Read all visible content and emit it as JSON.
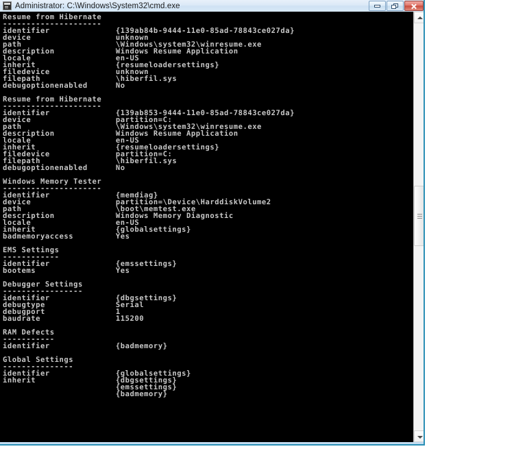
{
  "window": {
    "title": "Administrator: C:\\Windows\\System32\\cmd.exe",
    "icon": "cmd-console-icon",
    "controls": {
      "minimize": "Minimize",
      "restore": "Restore",
      "close": "Close"
    }
  },
  "console": {
    "background_color": "#000000",
    "text_color": "#c8c8c8",
    "lines": [
      "Resume from Hibernate",
      "---------------------",
      "identifier              {139ab84b-9444-11e0-85ad-78843ce027da}",
      "device                  unknown",
      "path                    \\Windows\\system32\\winresume.exe",
      "description             Windows Resume Application",
      "locale                  en-US",
      "inherit                 {resumeloadersettings}",
      "filedevice              unknown",
      "filepath                \\hiberfil.sys",
      "debugoptionenabled      No",
      "",
      "Resume from Hibernate",
      "---------------------",
      "identifier              {139ab853-9444-11e0-85ad-78843ce027da}",
      "device                  partition=C:",
      "path                    \\Windows\\system32\\winresume.exe",
      "description             Windows Resume Application",
      "locale                  en-US",
      "inherit                 {resumeloadersettings}",
      "filedevice              partition=C:",
      "filepath                \\hiberfil.sys",
      "debugoptionenabled      No",
      "",
      "Windows Memory Tester",
      "---------------------",
      "identifier              {memdiag}",
      "device                  partition=\\Device\\HarddiskVolume2",
      "path                    \\boot\\memtest.exe",
      "description             Windows Memory Diagnostic",
      "locale                  en-US",
      "inherit                 {globalsettings}",
      "badmemoryaccess         Yes",
      "",
      "EMS Settings",
      "------------",
      "identifier              {emssettings}",
      "bootems                 Yes",
      "",
      "Debugger Settings",
      "-----------------",
      "identifier              {dbgsettings}",
      "debugtype               Serial",
      "debugport               1",
      "baudrate                115200",
      "",
      "RAM Defects",
      "-----------",
      "identifier              {badmemory}",
      "",
      "Global Settings",
      "---------------",
      "identifier              {globalsettings}",
      "inherit                 {dbgsettings}",
      "                        {emssettings}",
      "                        {badmemory}"
    ]
  },
  "scrollbar": {
    "up_arrow": "scroll-up",
    "down_arrow": "scroll-down",
    "thumb": "scroll-thumb"
  }
}
